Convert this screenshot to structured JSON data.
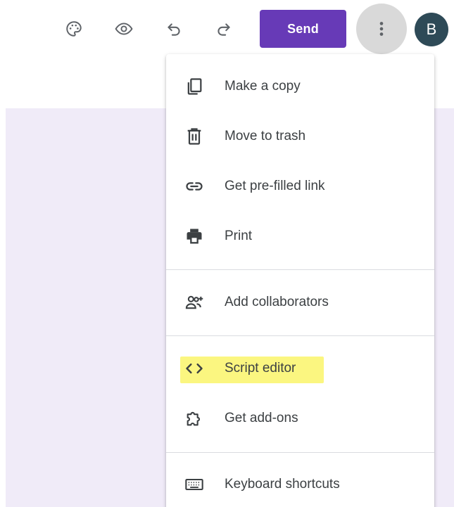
{
  "toolbar": {
    "send_label": "Send",
    "avatar_letter": "B",
    "icons": [
      "palette-icon",
      "preview-eye-icon",
      "undo-icon",
      "redo-icon",
      "more-vert-icon"
    ]
  },
  "menu": {
    "items": [
      {
        "label": "Make a copy",
        "icon": "copy-icon"
      },
      {
        "label": "Move to trash",
        "icon": "trash-icon"
      },
      {
        "label": "Get pre-filled link",
        "icon": "link-icon"
      },
      {
        "label": "Print",
        "icon": "print-icon"
      },
      {
        "label": "Add collaborators",
        "icon": "add-people-icon"
      },
      {
        "label": "Script editor",
        "icon": "code-icon",
        "highlighted": true
      },
      {
        "label": "Get add-ons",
        "icon": "puzzle-icon"
      },
      {
        "label": "Keyboard shortcuts",
        "icon": "keyboard-icon"
      }
    ]
  },
  "colors": {
    "accent": "#673ab7",
    "page_background": "#f0ebf8",
    "highlight": "#fbf680",
    "avatar": "#2e4a57"
  }
}
